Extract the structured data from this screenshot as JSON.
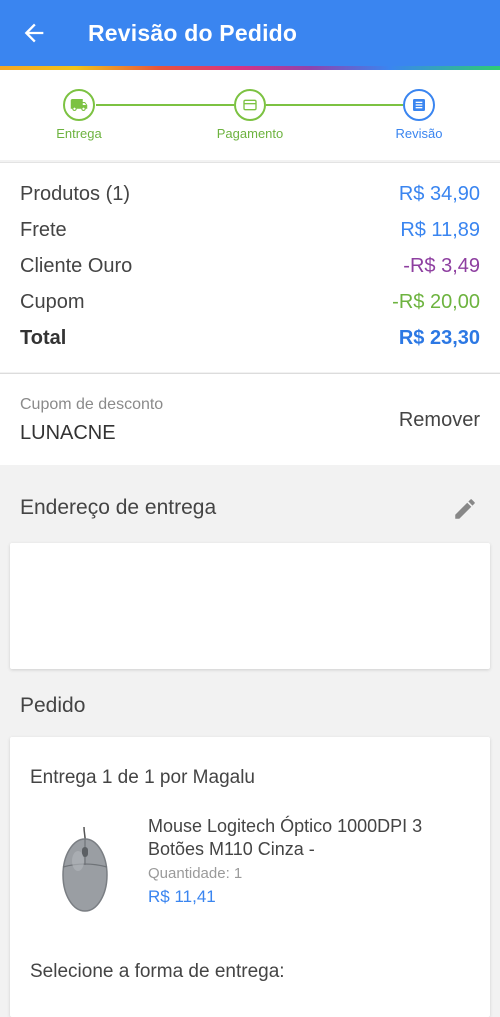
{
  "header": {
    "title": "Revisão do Pedido"
  },
  "steps": [
    {
      "label": "Entrega",
      "icon": "truck-icon"
    },
    {
      "label": "Pagamento",
      "icon": "card-icon"
    },
    {
      "label": "Revisão",
      "icon": "list-icon"
    }
  ],
  "summary": {
    "rows": [
      {
        "label": "Produtos (1)",
        "value": "R$ 34,90"
      },
      {
        "label": "Frete",
        "value": "R$ 11,89"
      },
      {
        "label": "Cliente Ouro",
        "value": "-R$ 3,49"
      },
      {
        "label": "Cupom",
        "value": "-R$ 20,00"
      },
      {
        "label": "Total",
        "value": "R$ 23,30"
      }
    ]
  },
  "coupon": {
    "label": "Cupom de desconto",
    "code": "LUNACNE",
    "remove_label": "Remover"
  },
  "address": {
    "title": "Endereço de entrega"
  },
  "order": {
    "title": "Pedido",
    "delivery_title": "Entrega 1 de 1 por Magalu",
    "product_name": "Mouse Logitech Óptico 1000DPI 3 Botões M110 Cinza -",
    "quantity_label": "Quantidade:",
    "quantity_value": "1",
    "price": "R$ 11,41",
    "select_delivery": "Selecione a forma de entrega:"
  },
  "colors": {
    "primary": "#3a85f0",
    "green": "#7cc242",
    "purple": "#8e3fa0"
  }
}
